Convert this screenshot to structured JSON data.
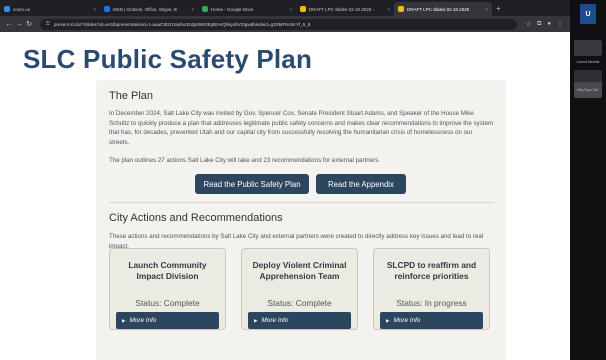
{
  "browser": {
    "tabs": [
      {
        "label": "zoom.us",
        "active": false,
        "color": "#2d8cff"
      },
      {
        "label": "MSN | Outlook, Office, Skype, B",
        "active": false,
        "color": "#1a73e8"
      },
      {
        "label": "Home - Google Drive",
        "active": false,
        "color": "#34a853"
      },
      {
        "label": "DRAFT LPC Slides 02.18.2025 -",
        "active": false,
        "color": "#fbbc04"
      },
      {
        "label": "DRAFT LPC Slides 02.18.2025",
        "active": true,
        "color": "#fbbc04"
      }
    ],
    "new_tab": "+",
    "url": "present.sl.do/?/slides?id=es1lbpresentationid=1-auaCtBG1ts&fv4Zrdpz6W2Ej8EHrQhkyshVZigw8bsideid=g3SMFNc9cYf_5_8",
    "nav": {
      "back": "←",
      "forward": "→",
      "reload": "↻"
    }
  },
  "page": {
    "title": "SLC Public Safety Plan",
    "plan": {
      "heading": "The Plan",
      "paragraph1": "In December 2024, Salt Lake City was invited by Gov. Spencer Cox, Senate President Stuart Adams, and Speaker of the House Mike Schultz to quickly produce a plan that addresses legitimate public safety concerns and makes clear recommendations to improve the system that has, for decades, prevented Utah and our capital city from successfully resolving the humanitarian crisis of homelessness on our streets.",
      "paragraph2": "The plan outlines 27 actions Salt Lake City will take and 23 recommendations for external partners.",
      "btn_plan": "Read the Public Safety Plan",
      "btn_appendix": "Read the Appendix"
    },
    "actions": {
      "heading": "City Actions and Recommendations",
      "paragraph": "These actions and recommendations by Salt Lake City and external partners were created to directly address key issues and lead to real impact.",
      "cards": [
        {
          "title": "Launch Community Impact Division",
          "status": "Status: Complete",
          "more": "More Info"
        },
        {
          "title": "Deploy Violent Criminal Apprehension Team",
          "status": "Status: Complete",
          "more": "More Info"
        },
        {
          "title": "SLCPD to reaffirm and reinforce priorities",
          "status": "Status: In progress",
          "more": "More Info"
        }
      ]
    }
  },
  "sidebar": {
    "logo": "U",
    "labels": [
      "Council Member",
      "Meg Ryan Sis7"
    ]
  }
}
